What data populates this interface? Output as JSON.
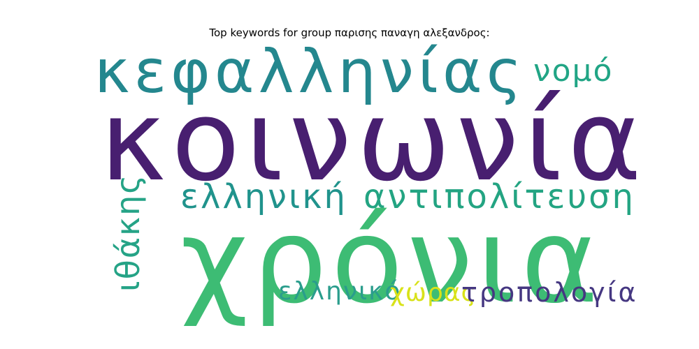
{
  "title": "Top keywords for group παρισης παναγη αλεξανδρος:",
  "words": [
    {
      "text": "κεφαλληνίας",
      "color": "#24878e"
    },
    {
      "text": "κοινωνία",
      "color": "#481f70"
    },
    {
      "text": "νομό",
      "color": "#21a585"
    },
    {
      "text": "ελληνική",
      "color": "#20938c"
    },
    {
      "text": "αντιπολίτευση",
      "color": "#23a482"
    },
    {
      "text": "χρόνια",
      "color": "#3dbc74"
    },
    {
      "text": "ιθάκης",
      "color": "#25a386"
    },
    {
      "text": "ελληνικό",
      "color": "#2a9d8c"
    },
    {
      "text": "χώρας",
      "color": "#d8e219"
    },
    {
      "text": "τροπολογία",
      "color": "#453781"
    }
  ]
}
